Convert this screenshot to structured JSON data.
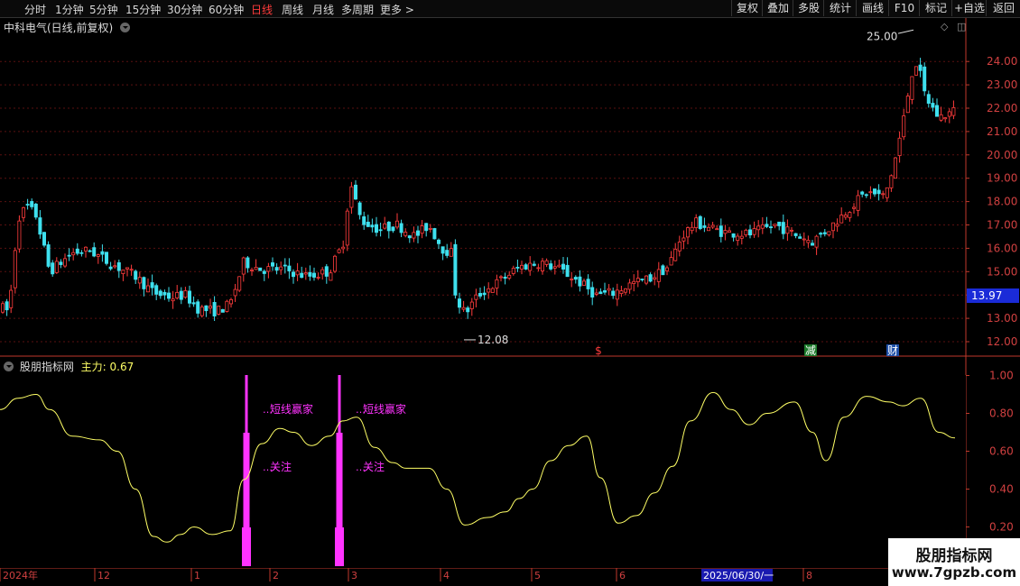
{
  "toolbar": {
    "periods": [
      "分时",
      "1分钟",
      "5分钟",
      "15分钟",
      "30分钟",
      "60分钟",
      "日线",
      "周线",
      "月线",
      "多周期",
      "更多 >"
    ],
    "active_period": "日线",
    "buttons": [
      "复权",
      "叠加",
      "多股",
      "统计",
      "画线",
      "F10",
      "标记",
      "+自选",
      "返回"
    ]
  },
  "stock_title": "中科电气(日线,前复权)",
  "indicator": {
    "name": "股朋指标网",
    "main_label": "主力:",
    "main_value": "0.67"
  },
  "watermark": {
    "title": "股朋指标网",
    "url": "www.7gpzb.com"
  },
  "colors": {
    "up": "#ff3c3c",
    "down": "#3ee0ee",
    "indicator_line": "#ffff66",
    "signal": "#ff33ff",
    "axis": "#c0392b"
  },
  "chart_data": [
    {
      "type": "candlestick",
      "ylim": [
        11.6,
        25.3
      ],
      "yticks": [
        "12.00",
        "13.00",
        "14.00",
        "15.00",
        "16.00",
        "17.00",
        "18.00",
        "19.00",
        "20.00",
        "21.00",
        "22.00",
        "23.00",
        "24.00"
      ],
      "last_price": "13.97",
      "annotations": {
        "high": "25.00",
        "low": "12.08"
      },
      "event_markers": [
        "$",
        "减",
        "财"
      ],
      "price_path": [
        [
          0,
          13.5
        ],
        [
          10,
          13.3
        ],
        [
          20,
          17.3
        ],
        [
          30,
          17.8
        ],
        [
          40,
          17.4
        ],
        [
          55,
          15.0
        ],
        [
          80,
          15.8
        ],
        [
          100,
          15.9
        ],
        [
          120,
          15.4
        ],
        [
          150,
          14.8
        ],
        [
          170,
          14.1
        ],
        [
          190,
          13.9
        ],
        [
          205,
          14.0
        ],
        [
          220,
          13.4
        ],
        [
          240,
          13.3
        ],
        [
          255,
          13.6
        ],
        [
          270,
          15.4
        ],
        [
          290,
          15.1
        ],
        [
          315,
          15.1
        ],
        [
          340,
          14.8
        ],
        [
          365,
          15.0
        ],
        [
          380,
          16.2
        ],
        [
          388,
          18.8
        ],
        [
          400,
          17.2
        ],
        [
          420,
          16.8
        ],
        [
          440,
          17.0
        ],
        [
          460,
          16.5
        ],
        [
          475,
          17.0
        ],
        [
          490,
          16.0
        ],
        [
          500,
          15.8
        ],
        [
          505,
          13.9
        ],
        [
          515,
          13.2
        ],
        [
          530,
          14.0
        ],
        [
          550,
          14.5
        ],
        [
          575,
          15.2
        ],
        [
          600,
          15.4
        ],
        [
          620,
          15.1
        ],
        [
          640,
          14.6
        ],
        [
          660,
          14.0
        ],
        [
          680,
          14.1
        ],
        [
          700,
          14.5
        ],
        [
          720,
          14.7
        ],
        [
          740,
          15.2
        ],
        [
          755,
          16.5
        ],
        [
          770,
          17.1
        ],
        [
          800,
          16.7
        ],
        [
          830,
          16.6
        ],
        [
          860,
          17.0
        ],
        [
          880,
          16.6
        ],
        [
          900,
          16.3
        ],
        [
          920,
          16.9
        ],
        [
          940,
          17.7
        ],
        [
          960,
          18.4
        ],
        [
          980,
          18.2
        ],
        [
          990,
          19.5
        ],
        [
          1000,
          21.3
        ],
        [
          1010,
          23.5
        ],
        [
          1016,
          24.0
        ],
        [
          1025,
          22.5
        ],
        [
          1040,
          21.6
        ],
        [
          1058,
          21.9
        ]
      ]
    },
    {
      "type": "line",
      "ylim": [
        0.07,
        1.1
      ],
      "yticks": [
        "0.20",
        "0.40",
        "0.60",
        "0.80",
        "1.00"
      ],
      "series": [
        {
          "name": "主力",
          "values": [
            [
              0,
              0.82
            ],
            [
              20,
              0.88
            ],
            [
              40,
              0.9
            ],
            [
              55,
              0.82
            ],
            [
              80,
              0.68
            ],
            [
              110,
              0.66
            ],
            [
              130,
              0.6
            ],
            [
              150,
              0.4
            ],
            [
              170,
              0.15
            ],
            [
              185,
              0.12
            ],
            [
              200,
              0.16
            ],
            [
              215,
              0.2
            ],
            [
              235,
              0.16
            ],
            [
              255,
              0.18
            ],
            [
              270,
              0.45
            ],
            [
              290,
              0.64
            ],
            [
              310,
              0.72
            ],
            [
              325,
              0.7
            ],
            [
              345,
              0.63
            ],
            [
              365,
              0.68
            ],
            [
              380,
              0.76
            ],
            [
              395,
              0.78
            ],
            [
              415,
              0.62
            ],
            [
              435,
              0.54
            ],
            [
              450,
              0.51
            ],
            [
              475,
              0.51
            ],
            [
              495,
              0.4
            ],
            [
              515,
              0.21
            ],
            [
              540,
              0.25
            ],
            [
              560,
              0.28
            ],
            [
              575,
              0.35
            ],
            [
              590,
              0.4
            ],
            [
              610,
              0.55
            ],
            [
              630,
              0.63
            ],
            [
              650,
              0.68
            ],
            [
              665,
              0.46
            ],
            [
              685,
              0.22
            ],
            [
              705,
              0.26
            ],
            [
              725,
              0.38
            ],
            [
              745,
              0.52
            ],
            [
              765,
              0.76
            ],
            [
              790,
              0.91
            ],
            [
              810,
              0.82
            ],
            [
              830,
              0.74
            ],
            [
              850,
              0.8
            ],
            [
              880,
              0.86
            ],
            [
              900,
              0.7
            ],
            [
              915,
              0.55
            ],
            [
              935,
              0.78
            ],
            [
              960,
              0.89
            ],
            [
              985,
              0.86
            ],
            [
              1000,
              0.84
            ],
            [
              1020,
              0.88
            ],
            [
              1040,
              0.7
            ],
            [
              1058,
              0.67
            ]
          ]
        }
      ],
      "signals": [
        {
          "x": 273,
          "label_top": "短线赢家",
          "label_bottom": "关注"
        },
        {
          "x": 376,
          "label_top": "短线赢家",
          "label_bottom": "关注"
        }
      ]
    }
  ],
  "date_axis": [
    "2024年",
    "12",
    "1",
    "2",
    "3",
    "4",
    "5",
    "6",
    "2025/06/30/一",
    "8"
  ]
}
